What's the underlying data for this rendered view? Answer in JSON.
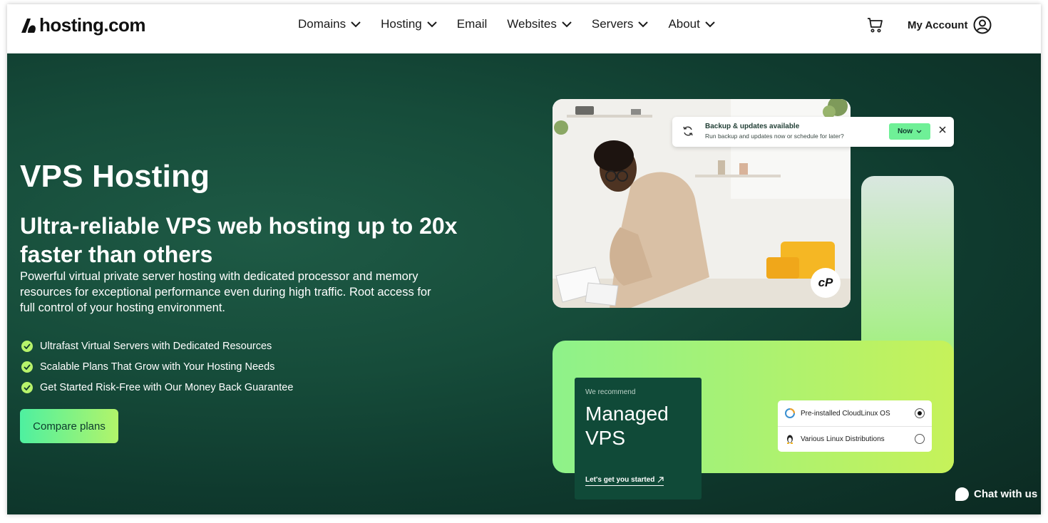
{
  "brand": {
    "name": "hosting.com"
  },
  "nav": {
    "items": [
      {
        "label": "Domains",
        "has_dropdown": true
      },
      {
        "label": "Hosting",
        "has_dropdown": true
      },
      {
        "label": "Email",
        "has_dropdown": false
      },
      {
        "label": "Websites",
        "has_dropdown": true
      },
      {
        "label": "Servers",
        "has_dropdown": true
      },
      {
        "label": "About",
        "has_dropdown": true
      }
    ],
    "cart_icon": "cart-icon",
    "account_label": "My Account",
    "account_icon": "user-circle-icon"
  },
  "hero": {
    "title": "VPS Hosting",
    "subtitle": "Ultra-reliable VPS web hosting up to 20x faster than others",
    "description": "Powerful virtual private server hosting with dedicated processor and memory resources for exceptional performance even during high traffic. Root access for full control of your hosting environment.",
    "features": [
      "Ultrafast Virtual Servers with Dedicated Resources",
      "Scalable Plans That Grow with Your Hosting Needs",
      "Get Started Risk-Free with Our Money Back Guarantee"
    ],
    "cta_label": "Compare plans"
  },
  "notification": {
    "title": "Backup & updates available",
    "text": "Run backup and updates now or schedule for later?",
    "button_label": "Now"
  },
  "cpanel_badge": "cP",
  "recommend_card": {
    "kicker": "We recommend",
    "title_line1": "Managed",
    "title_line2": "VPS",
    "link_label": "Let's get you started"
  },
  "os_options": [
    {
      "label": "Pre-installed CloudLinux OS",
      "selected": true,
      "icon": "cloudlinux-icon"
    },
    {
      "label": "Various Linux Distributions",
      "selected": false,
      "icon": "tux-icon"
    }
  ],
  "chat": {
    "label": "Chat with us"
  },
  "colors": {
    "hero_bg": "#164c3a",
    "accent_green": "#b7f36b",
    "cta_gradient_start": "#4ef0a0",
    "cta_gradient_end": "#b2f46a"
  }
}
